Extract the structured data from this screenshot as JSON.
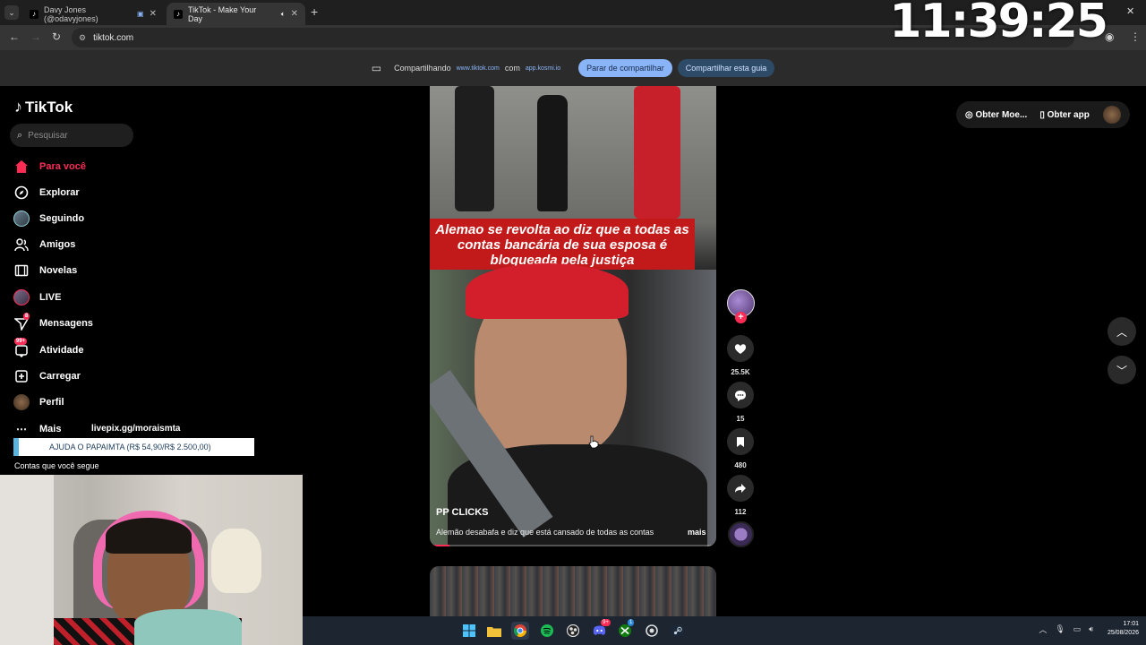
{
  "browser": {
    "tabs": [
      {
        "title": "Davy Jones (@odavyjones)",
        "active": false
      },
      {
        "title": "TikTok - Make Your Day",
        "active": true
      }
    ],
    "new_tab_symbol": "+",
    "address": "tiktok.com",
    "clock_overlay": "11:39:25"
  },
  "share_bar": {
    "label": "Compartilhando",
    "shared_site": "www.tiktok.com",
    "connector": "com",
    "shared_with": "app.kosmi.io",
    "stop_label": "Parar de compartilhar",
    "share_tab_label": "Compartilhar esta guia"
  },
  "sidebar": {
    "logo": "TikTok",
    "search_placeholder": "Pesquisar",
    "items": [
      {
        "label": "Para você",
        "icon": "home-icon",
        "active": true
      },
      {
        "label": "Explorar",
        "icon": "compass-icon"
      },
      {
        "label": "Seguindo",
        "icon": "following-avatar-icon"
      },
      {
        "label": "Amigos",
        "icon": "friends-icon"
      },
      {
        "label": "Novelas",
        "icon": "film-icon"
      },
      {
        "label": "LIVE",
        "icon": "live-icon"
      },
      {
        "label": "Mensagens",
        "icon": "send-icon",
        "badge": "8"
      },
      {
        "label": "Atividade",
        "icon": "inbox-icon",
        "badge": "99+"
      },
      {
        "label": "Carregar",
        "icon": "upload-icon"
      },
      {
        "label": "Perfil",
        "icon": "profile-avatar-icon"
      },
      {
        "label": "Mais",
        "icon": "more-icon"
      }
    ],
    "following_accounts_label": "Contas que você segue"
  },
  "stream_overlay": {
    "livepix": "livepix.gg/moraismta",
    "donation_goal": "AJUDA O PAPAIMTA (R$ 54,90/R$ 2.500,00)"
  },
  "video": {
    "caption_overlay": "Alemao se revolta ao diz que a todas as contas bancária de sua esposa é bloqueada pela justiça",
    "author": "PP CLICKS",
    "description": "Alemão desabafa e diz que está cansado de todas as contas",
    "more_label": "mais",
    "progress": 0.07
  },
  "actions": {
    "likes": "25.5K",
    "comments": "15",
    "saves": "480",
    "shares": "112"
  },
  "topright": {
    "coins_label": "Obter Moe...",
    "app_label": "Obter app"
  },
  "taskbar": {
    "time": "17:01",
    "date": "25/08/2026",
    "discord_badge": "9+",
    "xbox_badge": "1"
  },
  "colors": {
    "accent": "#fe2c55",
    "caption_bg": "#c21a1a",
    "share_stop_bg": "#8ab4f8"
  }
}
